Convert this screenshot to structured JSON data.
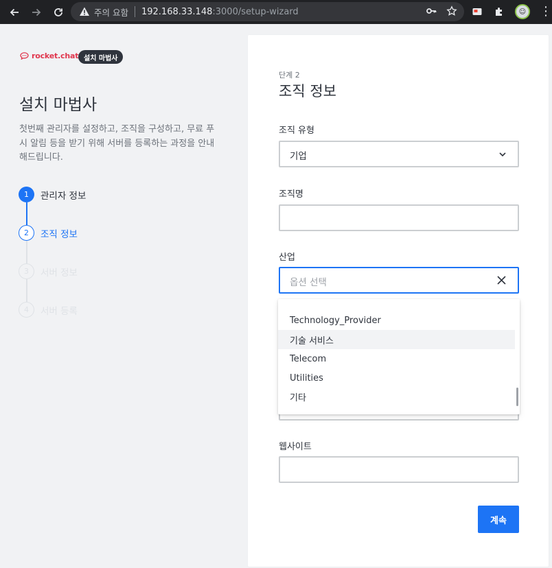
{
  "browser": {
    "security_warning": "주의 요함",
    "url_host": "192.168.33.148",
    "url_path": ":3000/setup-wizard",
    "avatar_text": "☺"
  },
  "brand": {
    "logo_text": "rocket.chat",
    "badge": "설치 마법사",
    "accent": "#e0364d"
  },
  "left": {
    "title": "설치 마법사",
    "description": "첫번째 관리자를 설정하고, 조직을 구성하고, 무료 푸시 알림 등을 받기 위해 서버를 등록하는 과정을 안내해드립니다.",
    "steps": [
      {
        "num": "1",
        "label": "관리자 정보",
        "state": "done"
      },
      {
        "num": "2",
        "label": "조직 정보",
        "state": "active"
      },
      {
        "num": "3",
        "label": "서버 정보",
        "state": "pending"
      },
      {
        "num": "4",
        "label": "서버 등록",
        "state": "pending"
      }
    ]
  },
  "form": {
    "step_label": "단계 2",
    "title": "조직 정보",
    "org_type_label": "조직 유형",
    "org_type_value": "기업",
    "org_name_label": "조직명",
    "org_name_value": "",
    "industry_label": "산업",
    "industry_placeholder": "옵션 선택",
    "website_label": "웹사이트",
    "website_value": "",
    "continue_label": "계속"
  },
  "industry_options": [
    {
      "label": "Technology_Provider"
    },
    {
      "label": "기술 서비스"
    },
    {
      "label": "Telecom"
    },
    {
      "label": "Utilities"
    },
    {
      "label": "기타"
    }
  ],
  "colors": {
    "primary": "#1d74f5",
    "dark": "#2f343d"
  }
}
